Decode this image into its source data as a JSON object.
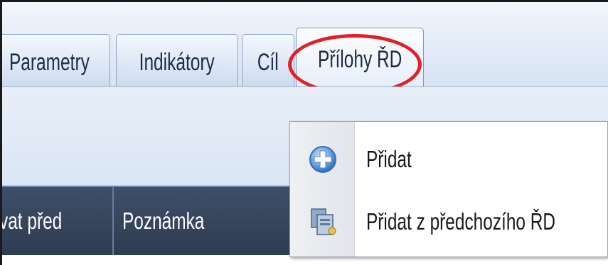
{
  "tabs": [
    {
      "label": "Parametry"
    },
    {
      "label": "Indikátory"
    },
    {
      "label": "Cíl"
    },
    {
      "label": "Přílohy ŘD",
      "selected": true
    }
  ],
  "grid": {
    "columns": [
      {
        "label": "vat před"
      },
      {
        "label": "Poznámka"
      }
    ]
  },
  "context_menu": {
    "items": [
      {
        "label": "Přidat",
        "icon": "plus-circle-icon"
      },
      {
        "label": "Přidat z předchozího ŘD",
        "icon": "copy-document-icon"
      }
    ]
  },
  "colors": {
    "highlight": "#e31f26",
    "header_bg": "#2f3c52",
    "tab_bg": "#dde7f5"
  }
}
